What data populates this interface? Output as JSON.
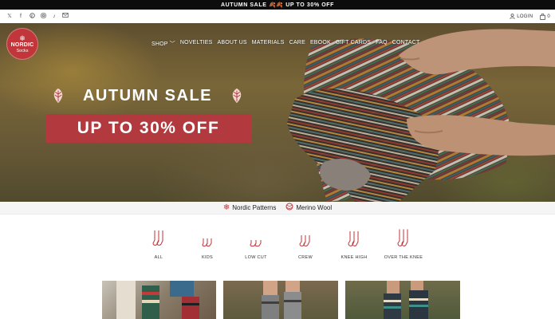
{
  "announcement": {
    "text": "AUTUMN SALE 🍂🍂 UP TO 30% OFF"
  },
  "social_icons": [
    "x-icon",
    "facebook-icon",
    "pinterest-icon",
    "instagram-icon",
    "tiktok-icon",
    "email-icon"
  ],
  "account": {
    "login_label": "LOGIN",
    "cart_count": "0"
  },
  "logo": {
    "line1": "NORDIC",
    "line2": "Socks"
  },
  "nav": {
    "shop": "SHOP",
    "novelties": "NOVELTIES",
    "about": "ABOUT US",
    "materials": "MATERIALS",
    "care": "CARE",
    "ebook": "EBOOK",
    "gift_cards": "GIFT CARDS",
    "faq": "FAQ",
    "contact": "CONTACT"
  },
  "hero": {
    "title": "AUTUMN SALE",
    "offer": "UP TO 30% OFF"
  },
  "features": [
    {
      "label": "Nordic Patterns",
      "icon": "snowflake-icon"
    },
    {
      "label": "Merino Wool",
      "icon": "yarn-ball-icon"
    }
  ],
  "categories": [
    {
      "label": "ALL"
    },
    {
      "label": "KIDS"
    },
    {
      "label": "LOW CUT"
    },
    {
      "label": "CREW"
    },
    {
      "label": "KNEE HIGH"
    },
    {
      "label": "OVER THE KNEE"
    }
  ],
  "colors": {
    "brand_red": "#b23a3e",
    "announce_bg": "#0d0d0d"
  }
}
